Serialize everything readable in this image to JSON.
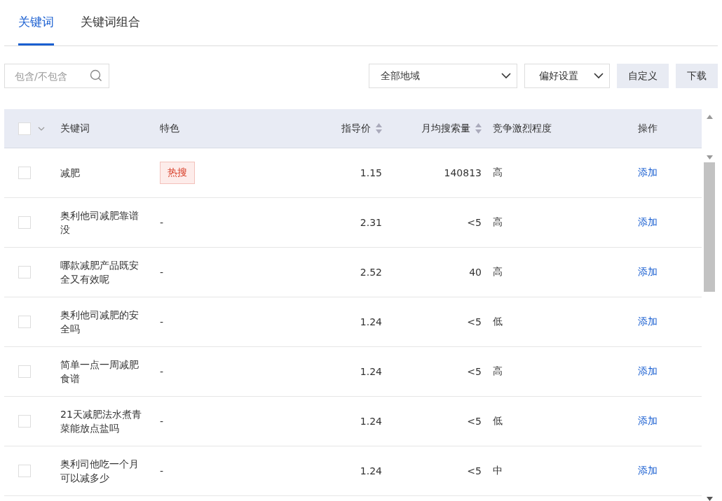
{
  "tabs": [
    {
      "label": "关键词",
      "selected": true
    },
    {
      "label": "关键词组合",
      "selected": false
    }
  ],
  "toolbar": {
    "search": {
      "placeholder": "包含/不包含"
    },
    "region_select": {
      "value": "全部地域"
    },
    "preference_select": {
      "value": "偏好设置"
    },
    "buttons": [
      "自定义",
      "下载"
    ]
  },
  "table": {
    "select_all": {
      "checked": false
    },
    "columns": [
      {
        "label": "关键词",
        "sortable": false
      },
      {
        "label": "特色",
        "sortable": false
      },
      {
        "label": "指导价",
        "sortable": true
      },
      {
        "label": "月均搜索量",
        "sortable": true
      },
      {
        "label": "竞争激烈程度",
        "sortable": false
      },
      {
        "label": "操作",
        "sortable": false
      }
    ],
    "rows": [
      {
        "checked": false,
        "keyword": "减肥",
        "feature": {
          "kind": "tag",
          "text": "热搜"
        },
        "price": "1.15",
        "searches": "140813",
        "competition": "高",
        "action": "添加"
      },
      {
        "checked": false,
        "keyword": "奥利他司减肥靠谱没",
        "feature": {
          "kind": "text",
          "text": "-"
        },
        "price": "2.31",
        "searches": "<5",
        "competition": "高",
        "action": "添加"
      },
      {
        "checked": false,
        "keyword": "哪款减肥产品既安全又有效呢",
        "feature": {
          "kind": "text",
          "text": "-"
        },
        "price": "2.52",
        "searches": "40",
        "competition": "高",
        "action": "添加"
      },
      {
        "checked": false,
        "keyword": "奥利他司减肥的安全吗",
        "feature": {
          "kind": "text",
          "text": "-"
        },
        "price": "1.24",
        "searches": "<5",
        "competition": "低",
        "action": "添加"
      },
      {
        "checked": false,
        "keyword": "简单一点一周减肥食谱",
        "feature": {
          "kind": "text",
          "text": "-"
        },
        "price": "1.24",
        "searches": "<5",
        "competition": "高",
        "action": "添加"
      },
      {
        "checked": false,
        "keyword": "21天减肥法水煮青菜能放点盐吗",
        "feature": {
          "kind": "text",
          "text": "-"
        },
        "price": "1.24",
        "searches": "<5",
        "competition": "低",
        "action": "添加"
      },
      {
        "checked": false,
        "keyword": "奥利司他吃一个月可以减多少",
        "feature": {
          "kind": "text",
          "text": "-"
        },
        "price": "1.24",
        "searches": "<5",
        "competition": "中",
        "action": "添加"
      }
    ]
  }
}
